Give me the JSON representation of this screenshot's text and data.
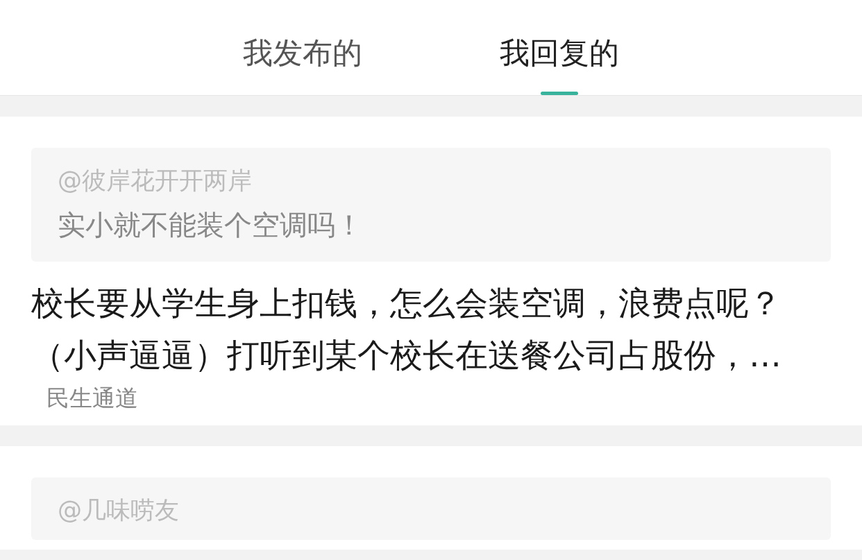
{
  "tabs": [
    {
      "label": "我发布的",
      "selected": false
    },
    {
      "label": "我回复的",
      "selected": true
    }
  ],
  "replies": [
    {
      "quote_author": "@彼岸花开开两岸",
      "quote_text": "实小就不能装个空调吗！",
      "reply_text": "校长要从学生身上扣钱，怎么会装空调，浪费点呢？（小声逼逼）打听到某个校长在送餐公司占股份，…",
      "channel": "民生通道"
    },
    {
      "quote_author": "@几味唠友"
    }
  ]
}
